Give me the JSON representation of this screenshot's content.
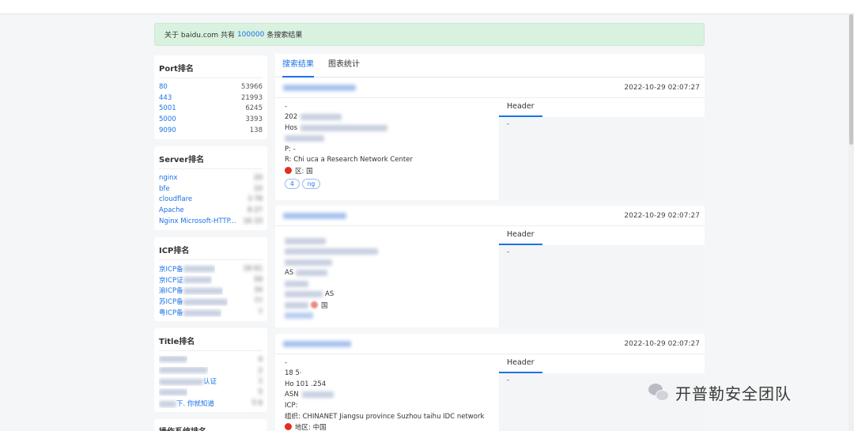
{
  "alert": {
    "prefix": "关于 baidu.com 共有",
    "count": "100000",
    "suffix": "条搜索结果"
  },
  "port_rank": {
    "title": "Port排名",
    "items": [
      {
        "key": "80",
        "value": "53966"
      },
      {
        "key": "443",
        "value": "21993"
      },
      {
        "key": "5001",
        "value": "6245"
      },
      {
        "key": "5000",
        "value": "3393"
      },
      {
        "key": "9090",
        "value": "138"
      }
    ]
  },
  "server_rank": {
    "title": "Server排名",
    "items": [
      {
        "key": "nginx",
        "value": "20"
      },
      {
        "key": "bfe",
        "value": "10"
      },
      {
        "key": "cloudflare",
        "value": "3 79"
      },
      {
        "key": "Apache",
        "value": "8 27"
      },
      {
        "key": "Nginx Microsoft-HTTP...",
        "value": "16 33"
      }
    ]
  },
  "icp_rank": {
    "title": "ICP排名",
    "items": [
      {
        "key": "京ICP备",
        "value": "16 61"
      },
      {
        "key": "京ICP证",
        "value": "59"
      },
      {
        "key": "渝ICP备",
        "value": "34"
      },
      {
        "key": "苏ICP备",
        "value": "77"
      },
      {
        "key": "粤ICP备",
        "value": "7"
      }
    ]
  },
  "title_rank": {
    "title": "Title排名",
    "items": [
      {
        "key": "",
        "value": "4"
      },
      {
        "key": "",
        "value": "2"
      },
      {
        "key": "认证",
        "value": "1"
      },
      {
        "key": "",
        "value": "5"
      },
      {
        "key": "下. 你就知道",
        "value": "5 6"
      }
    ]
  },
  "os_rank": {
    "title": "操作系统排名"
  },
  "tabs": [
    {
      "label": "搜索结果"
    },
    {
      "label": "图表统计"
    }
  ],
  "results": [
    {
      "time": "2022-10-29 02:07:27",
      "header_label": "Header",
      "header_value": "-",
      "lines": [
        "-",
        "202",
        "Hos",
        "",
        "P: -",
        "R: Chi uca a Research Network Center",
        "区: 国"
      ],
      "tags": [
        "4",
        "ng"
      ]
    },
    {
      "time": "2022-10-29 02:07:27",
      "header_label": "Header",
      "header_value": "-",
      "lines": [
        "",
        "",
        "",
        "AS",
        "",
        "AS",
        "国"
      ]
    },
    {
      "time": "2022-10-29 02:07:27",
      "header_label": "Header",
      "header_value": "-",
      "lines": [
        "-",
        "18 5·",
        "Ho 101 .254",
        "ASN",
        "ICP:",
        "组织: CHINANET Jiangsu province Suzhou taihu IDC network",
        "地区: 中国"
      ]
    }
  ],
  "watermark": {
    "text": "开普勒安全团队"
  },
  "colors": {
    "accent": "#1a73e8",
    "alert_bg": "#d9f2df",
    "flag_red": "#e03022"
  }
}
